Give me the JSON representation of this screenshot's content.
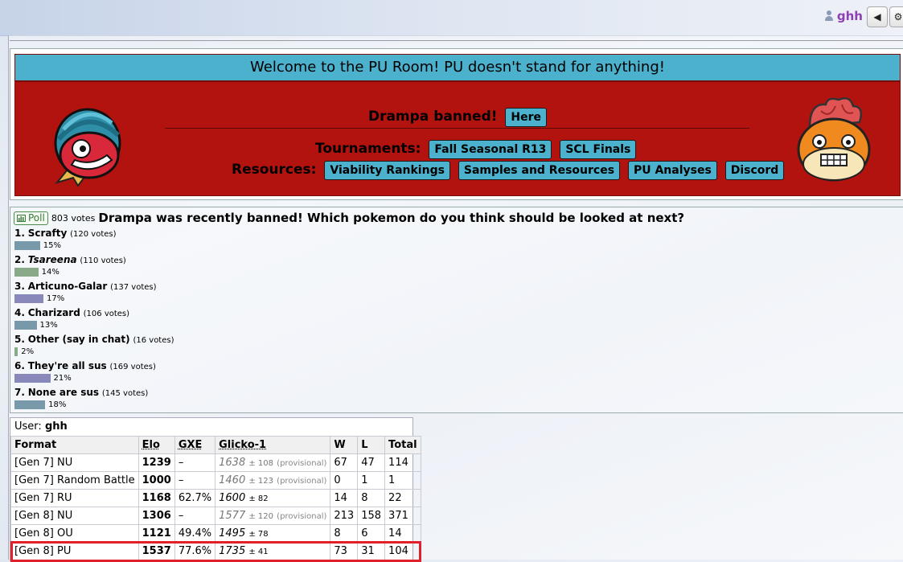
{
  "header": {
    "username": "ghh",
    "sound_icon": "speaker-icon",
    "settings_icon": "gear-icon"
  },
  "banner": {
    "welcome": "Welcome to the PU Room! PU doesn't stand for anything!",
    "announce_text": "Drampa banned!",
    "announce_button": "Here",
    "tournaments_label": "Tournaments:",
    "tournament_buttons": [
      "Fall Seasonal R13",
      "SCL Finals"
    ],
    "resources_label": "Resources:",
    "resource_buttons": [
      "Viability Rankings",
      "Samples and Resources",
      "PU Analyses",
      "Discord"
    ],
    "colors": {
      "banner_bg": "#b3130e",
      "accent": "#4bb1cd"
    }
  },
  "poll": {
    "tag": "Poll",
    "votes": "803 votes",
    "question": "Drampa was recently banned! Which pokemon do you think should be looked at next?",
    "options": [
      {
        "num": "1.",
        "name": "Scrafty",
        "votes": "(120 votes)",
        "pct_label": "15%",
        "pct": 15,
        "color": "#79a"
      },
      {
        "num": "2.",
        "name": "Tsareena",
        "votes": "(110 votes)",
        "pct_label": "14%",
        "pct": 14,
        "color": "#8a8"
      },
      {
        "num": "3.",
        "name": "Articuno-Galar",
        "votes": "(137 votes)",
        "pct_label": "17%",
        "pct": 17,
        "color": "#88b"
      },
      {
        "num": "4.",
        "name": "Charizard",
        "votes": "(106 votes)",
        "pct_label": "13%",
        "pct": 13,
        "color": "#79a"
      },
      {
        "num": "5.",
        "name": "Other (say in chat)",
        "votes": "(16 votes)",
        "pct_label": "2%",
        "pct": 2,
        "color": "#8a8"
      },
      {
        "num": "6.",
        "name": "They're all sus",
        "votes": "(169 votes)",
        "pct_label": "21%",
        "pct": 21,
        "color": "#88b"
      },
      {
        "num": "7.",
        "name": "None are sus",
        "votes": "(145 votes)",
        "pct_label": "18%",
        "pct": 18,
        "color": "#79a"
      }
    ]
  },
  "ratings": {
    "user_label": "User:",
    "user_name": "ghh",
    "columns": [
      "Format",
      "Elo",
      "GXE",
      "Glicko-1",
      "W",
      "L",
      "Total"
    ],
    "rows": [
      {
        "format": "[Gen 7] NU",
        "elo": "1239",
        "gxe": "–",
        "glicko": "1638",
        "dev": "± 108",
        "prov": "(provisional)",
        "w": "67",
        "l": "47",
        "total": "114"
      },
      {
        "format": "[Gen 7] Random Battle",
        "elo": "1000",
        "gxe": "–",
        "glicko": "1460",
        "dev": "± 123",
        "prov": "(provisional)",
        "w": "0",
        "l": "1",
        "total": "1"
      },
      {
        "format": "[Gen 7] RU",
        "elo": "1168",
        "gxe": "62.7%",
        "glicko": "1600",
        "dev": "± 82",
        "prov": "",
        "w": "14",
        "l": "8",
        "total": "22"
      },
      {
        "format": "[Gen 8] NU",
        "elo": "1306",
        "gxe": "–",
        "glicko": "1577",
        "dev": "± 120",
        "prov": "(provisional)",
        "w": "213",
        "l": "158",
        "total": "371"
      },
      {
        "format": "[Gen 8] OU",
        "elo": "1121",
        "gxe": "49.4%",
        "glicko": "1495",
        "dev": "± 78",
        "prov": "",
        "w": "8",
        "l": "6",
        "total": "14"
      },
      {
        "format": "[Gen 8] PU",
        "elo": "1537",
        "gxe": "77.6%",
        "glicko": "1735",
        "dev": "± 41",
        "prov": "",
        "w": "73",
        "l": "31",
        "total": "104"
      }
    ]
  }
}
